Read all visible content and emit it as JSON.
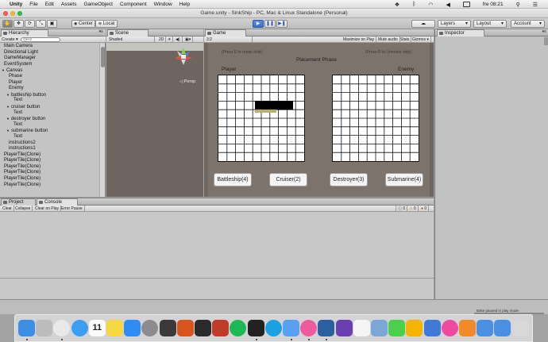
{
  "menubar": {
    "apple": "",
    "items": [
      "Unity",
      "File",
      "Edit",
      "Assets",
      "GameObject",
      "Component",
      "Window",
      "Help"
    ],
    "clock": "fre 08:21"
  },
  "window": {
    "title": "Game.unity - SinkShip - PC, Mac & Linux Standalone (Personal)"
  },
  "toolbar": {
    "center": "Center",
    "local": "Local",
    "layers": "Layers",
    "layout": "Layout",
    "account": "Account"
  },
  "hierarchy": {
    "tab": "Hierarchy",
    "create": "Create ▾",
    "search_placeholder": "Q▾All",
    "items": [
      {
        "label": "Main Camera",
        "indent": 0,
        "arrow": ""
      },
      {
        "label": "Directional Light",
        "indent": 0,
        "arrow": ""
      },
      {
        "label": "GameManager",
        "indent": 0,
        "arrow": ""
      },
      {
        "label": "EventSystem",
        "indent": 0,
        "arrow": ""
      },
      {
        "label": "Canvas",
        "indent": 0,
        "arrow": "▼"
      },
      {
        "label": "Phase",
        "indent": 1,
        "arrow": ""
      },
      {
        "label": "Player",
        "indent": 1,
        "arrow": ""
      },
      {
        "label": "Enemy",
        "indent": 1,
        "arrow": ""
      },
      {
        "label": "battleship button",
        "indent": 1,
        "arrow": "▼"
      },
      {
        "label": "Text",
        "indent": 2,
        "arrow": ""
      },
      {
        "label": "cruiser button",
        "indent": 1,
        "arrow": "▼"
      },
      {
        "label": "Text",
        "indent": 2,
        "arrow": ""
      },
      {
        "label": "destroyer button",
        "indent": 1,
        "arrow": "▼"
      },
      {
        "label": "Text",
        "indent": 2,
        "arrow": ""
      },
      {
        "label": "submarine button",
        "indent": 1,
        "arrow": "▼"
      },
      {
        "label": "Text",
        "indent": 2,
        "arrow": ""
      },
      {
        "label": "instructions2",
        "indent": 1,
        "arrow": ""
      },
      {
        "label": "instructions1",
        "indent": 1,
        "arrow": ""
      },
      {
        "label": "PlayerTile(Clone)",
        "indent": 0,
        "arrow": ""
      },
      {
        "label": "PlayerTile(Clone)",
        "indent": 0,
        "arrow": ""
      },
      {
        "label": "PlayerTile(Clone)",
        "indent": 0,
        "arrow": ""
      },
      {
        "label": "PlayerTile(Clone)",
        "indent": 0,
        "arrow": ""
      },
      {
        "label": "PlayerTile(Clone)",
        "indent": 0,
        "arrow": ""
      },
      {
        "label": "PlayerTile(Clone)",
        "indent": 0,
        "arrow": ""
      }
    ]
  },
  "scene": {
    "tab": "Scene",
    "shaded": "Shaded",
    "mode2d": "2D",
    "persp": "◁ Persp"
  },
  "game": {
    "tab": "Game",
    "aspect": "3:2",
    "maximize": "Maximize on Play",
    "mute": "Mute audio",
    "stats": "Stats",
    "gizmos": "Gizmos ▾",
    "instr_left": "(Press E to rotate ship)",
    "instr_right": "(Press R to Unrotate ship)",
    "phase": "Placement Phase",
    "player_label": "Player",
    "enemy_label": "Enemy",
    "buttons": [
      "Battleship(4)",
      "Cruiser(2)",
      "Destroyer(3)",
      "Submarine(4)"
    ]
  },
  "inspector": {
    "tab": "Inspector"
  },
  "console": {
    "project_tab": "Project",
    "console_tab": "Console",
    "clear": "Clear",
    "collapse": "Collapse",
    "clear_on_play": "Clear on Play",
    "error_pause": "Error Pause",
    "counts": [
      "0",
      "0",
      "0"
    ]
  },
  "status": {
    "bake": "Bake paused in play mode"
  },
  "dock": {
    "calendar_day": "11",
    "apps": [
      "finder-icon",
      "launchpad-icon",
      "chrome-icon",
      "safari-icon",
      "calendar-icon",
      "notes-icon",
      "app-store-icon",
      "system-preferences-icon",
      "activity-monitor-icon",
      "e-app-icon",
      "gear-app-icon",
      "photo-booth-icon",
      "spotify-icon",
      "unity-icon",
      "skype-icon",
      "mail-icon",
      "osu-icon",
      "unity-hub-icon",
      "visual-studio-icon",
      "photos-icon",
      "preview-icon",
      "messages-icon",
      "sketch-icon",
      "xcode-icon",
      "itunes-icon",
      "books-icon",
      "downloads-folder-icon",
      "documents-folder-icon",
      "trash-icon"
    ]
  }
}
